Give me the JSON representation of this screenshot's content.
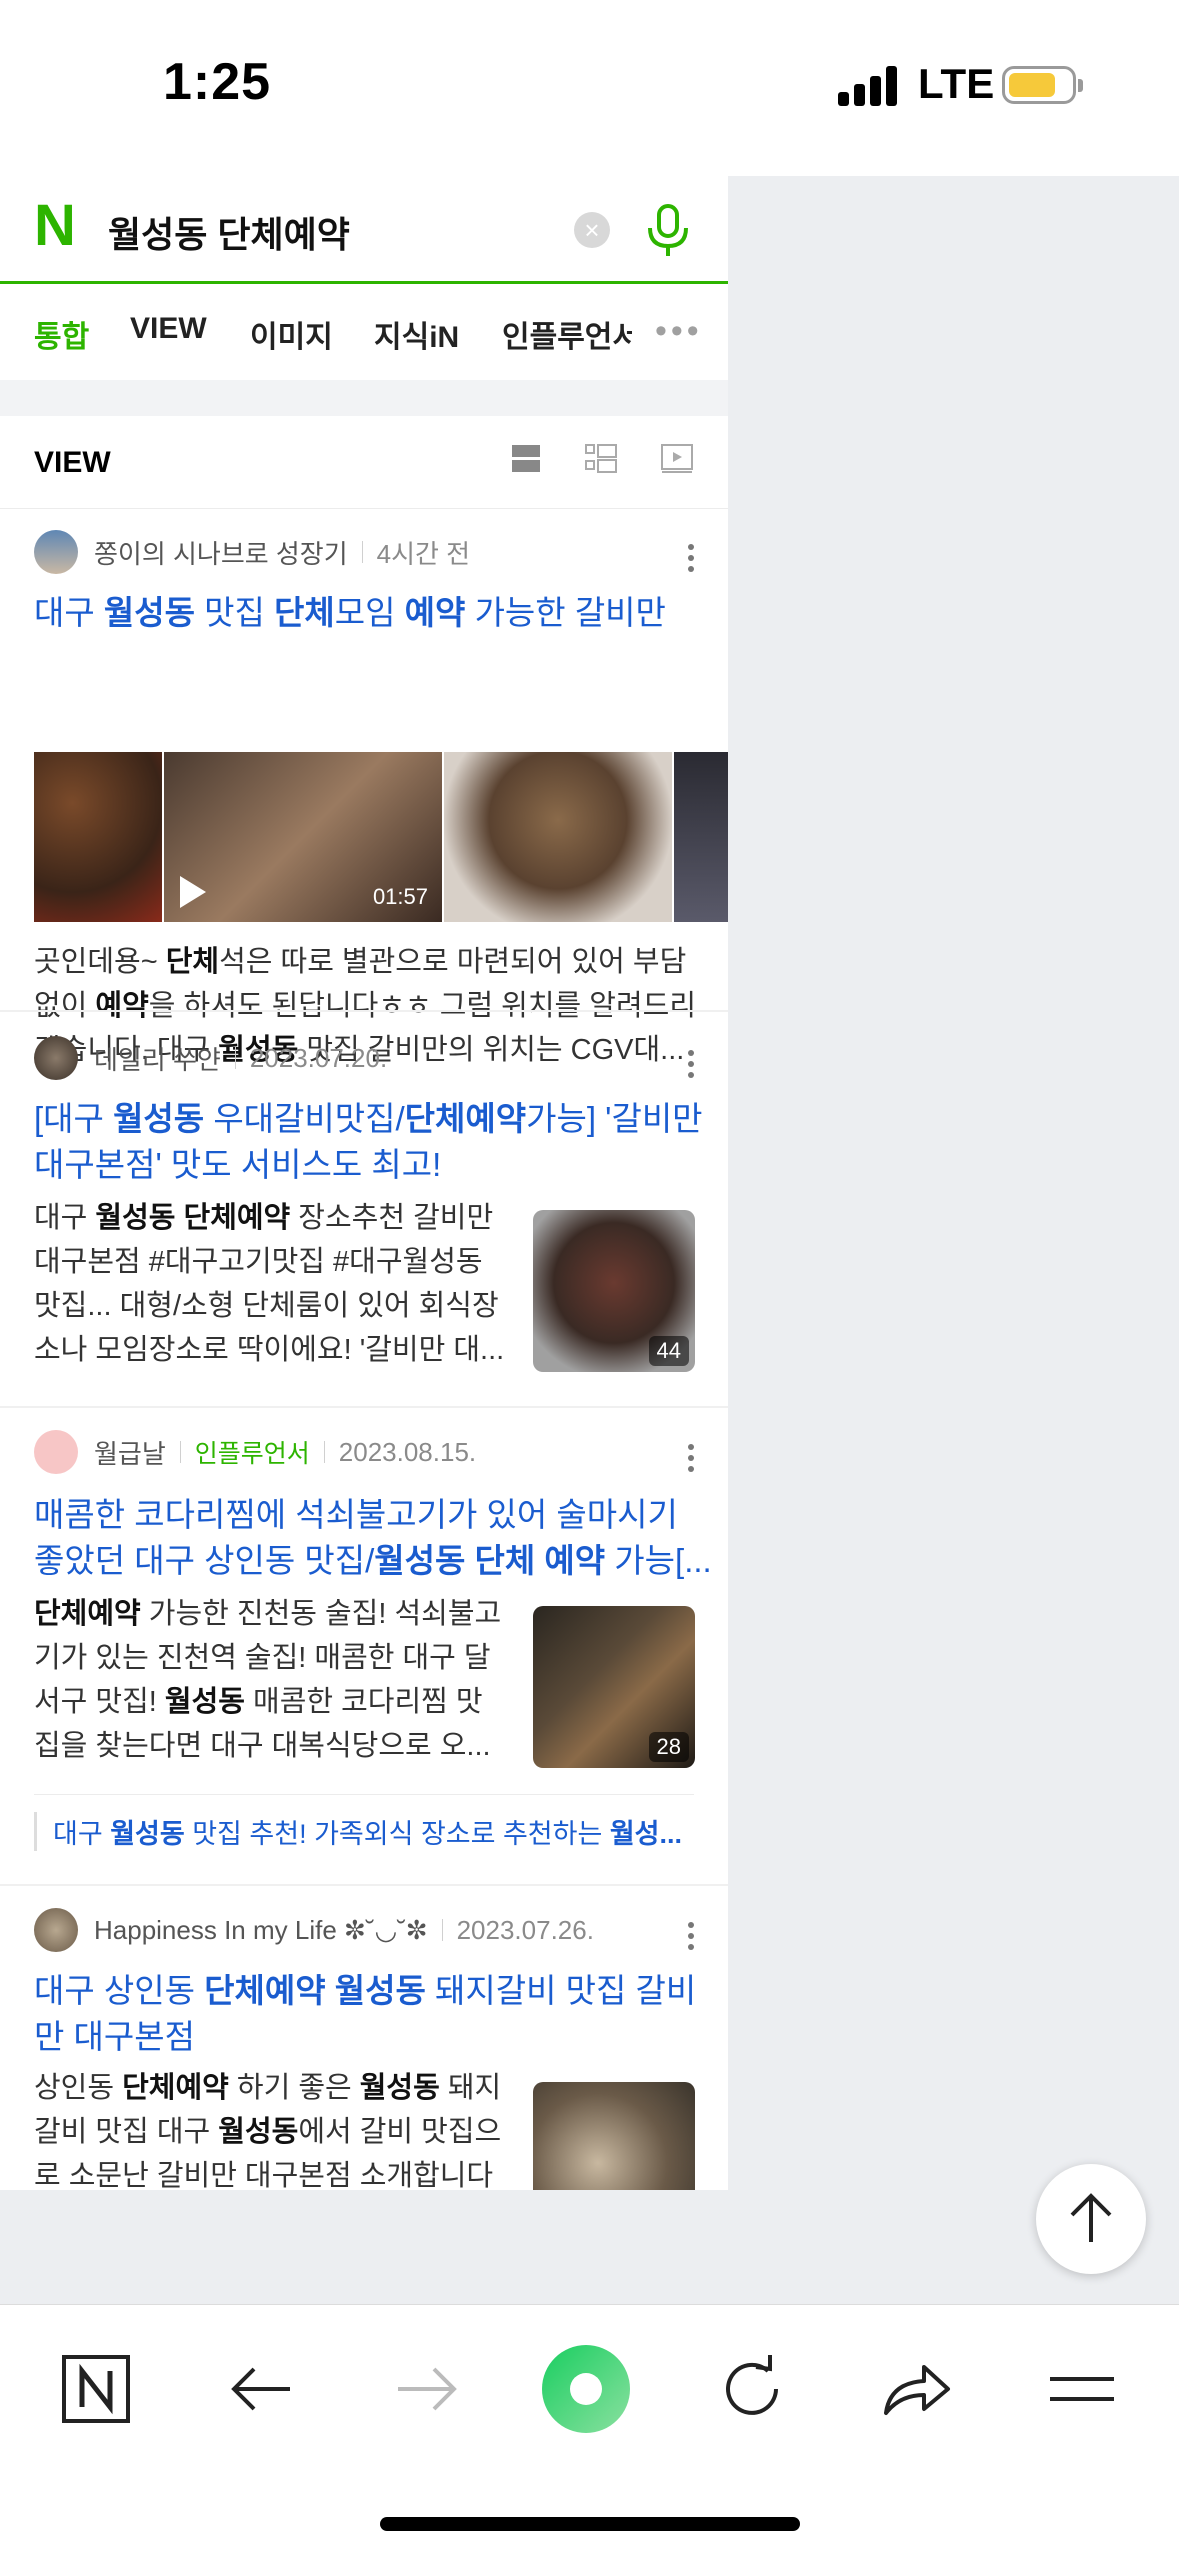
{
  "status_bar": {
    "time": "1:25",
    "network": "LTE",
    "battery_color": "#f6c93a"
  },
  "search": {
    "logo": "N",
    "query": "월성동 단체예약",
    "clear_icon": "clear-icon",
    "voice_icon": "mic-icon"
  },
  "tabs": [
    "통합",
    "VIEW",
    "이미지",
    "지식iN",
    "인플루언서"
  ],
  "active_tab": "통합",
  "section": {
    "title": "VIEW"
  },
  "posts": [
    {
      "author": "쫑이의 시나브로 성장기",
      "date": "4시간 전",
      "title": [
        [
          "대구 ",
          false
        ],
        [
          "월성동",
          true
        ],
        [
          " 맛집 ",
          false
        ],
        [
          "단체",
          true
        ],
        [
          "모임 ",
          false
        ],
        [
          "예약",
          true
        ],
        [
          " 가능한 갈비만",
          false
        ]
      ],
      "video_duration": "01:57",
      "desc": [
        [
          [
            "곳인데용~ ",
            false
          ],
          [
            "단체",
            true
          ],
          [
            "석은 따로 별관으로 마련되어 있어 부담",
            false
          ]
        ],
        [
          [
            "없이 ",
            false
          ],
          [
            "예약",
            true
          ],
          [
            "을 하셔도 된답니다ㅎㅎ 그럼 위치를 알려드리",
            false
          ]
        ],
        [
          [
            "겠습니다. 대구 ",
            false
          ],
          [
            "월성동",
            true
          ],
          [
            " 맛집 갈비만의 위치는 CGV대...",
            false
          ]
        ]
      ]
    },
    {
      "author": "데일리 쑤얀",
      "date": "2023.07.20.",
      "title_lines": [
        [
          [
            "[대구 ",
            false
          ],
          [
            "월성동",
            true
          ],
          [
            " 우대갈비맛집/",
            false
          ],
          [
            "단체예약",
            true
          ],
          [
            "가능] '갈비만",
            false
          ]
        ],
        [
          [
            "대구본점' 맛도 서비스도 최고!",
            false
          ]
        ]
      ],
      "desc": [
        [
          [
            "대구 ",
            false
          ],
          [
            "월성동 단체예약",
            true
          ],
          [
            " 장소추천 갈비만",
            false
          ]
        ],
        [
          [
            "대구본점 #대구고기맛집 #대구월성동",
            false
          ]
        ],
        [
          [
            "맛집... 대형/소형 단체룸이 있어 회식장",
            false
          ]
        ],
        [
          [
            "소나 모임장소로 딱이에요! '갈비만 대...",
            false
          ]
        ]
      ],
      "thumb_count": "44"
    },
    {
      "author": "월급날",
      "badge": "인플루언서",
      "date": "2023.08.15.",
      "title_lines": [
        [
          [
            "매콤한 코다리찜에 석쇠불고기가 있어 술마시기",
            false
          ]
        ],
        [
          [
            "좋았던 대구 상인동 맛집/",
            false
          ],
          [
            "월성동 단체 예약",
            true
          ],
          [
            " 가능[...",
            false
          ]
        ]
      ],
      "desc": [
        [
          [
            "단체예약",
            true
          ],
          [
            " 가능한 진천동 술집! 석쇠불고",
            false
          ]
        ],
        [
          [
            "기가 있는 진천역 술집! 매콤한 대구 달",
            false
          ]
        ],
        [
          [
            "서구 맛집! ",
            false
          ],
          [
            "월성동",
            true
          ],
          [
            " 매콤한 코다리찜 맛",
            false
          ]
        ],
        [
          [
            "집을 찾는다면 대구 대복식당으로 오...",
            false
          ]
        ]
      ],
      "thumb_count": "28",
      "related": [
        [
          "대구 ",
          false
        ],
        [
          "월성동",
          true
        ],
        [
          " 맛집 추천! 가족외식 장소로 추천하는 ",
          false
        ],
        [
          "월성...",
          true
        ]
      ]
    },
    {
      "author": "Happiness In my Life ✼˘◡˘✼",
      "date": "2023.07.26.",
      "title_lines": [
        [
          [
            "대구 상인동 ",
            false
          ],
          [
            "단체예약 월성동",
            true
          ],
          [
            " 돼지갈비 맛집 갈비",
            false
          ]
        ],
        [
          [
            "만 대구본점",
            false
          ]
        ]
      ],
      "desc": [
        [
          [
            "상인동 ",
            false
          ],
          [
            "단체예약",
            true
          ],
          [
            " 하기 좋은 ",
            false
          ],
          [
            "월성동",
            true
          ],
          [
            " 돼지",
            false
          ]
        ],
        [
          [
            "갈비 맛집 대구 ",
            false
          ],
          [
            "월성동",
            true
          ],
          [
            "에서 갈비 맛집으",
            false
          ]
        ],
        [
          [
            "로 소문난 갈비만 대구본점 소개합니다",
            false
          ]
        ]
      ]
    }
  ],
  "toolbar": [
    "naver-home-icon",
    "back-arrow-icon",
    "forward-arrow-icon",
    "green-dot-icon",
    "reload-icon",
    "share-icon",
    "menu-icon"
  ],
  "colors": {
    "naver_green": "#2db400",
    "link_blue": "#1a5ccf"
  }
}
